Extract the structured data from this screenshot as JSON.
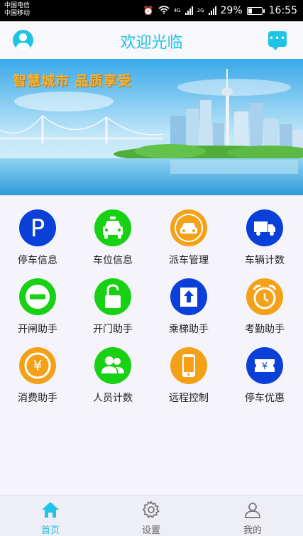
{
  "status_bar": {
    "carrier_1": "中国电信",
    "carrier_2": "中国移动",
    "network_1": "4G",
    "network_2": "2G",
    "battery": "29%",
    "battery_level": 0.29,
    "time": "16:55"
  },
  "header": {
    "title": "欢迎光临",
    "left_icon": "user-avatar-icon",
    "right_icon": "message-bubble-icon"
  },
  "banner": {
    "caption": "智慧城市  品质享受"
  },
  "grid": [
    {
      "label": "停车信息",
      "icon": "parking-icon",
      "color": "#0a3fd8"
    },
    {
      "label": "车位信息",
      "icon": "taxi-icon",
      "color": "#17d112"
    },
    {
      "label": "派车管理",
      "icon": "car-dispatch-icon",
      "color": "#f5a117"
    },
    {
      "label": "车辆计数",
      "icon": "truck-icon",
      "color": "#0a3fd8"
    },
    {
      "label": "开闸助手",
      "icon": "no-entry-icon",
      "color": "#17d112"
    },
    {
      "label": "开门助手",
      "icon": "padlock-icon",
      "color": "#17d112"
    },
    {
      "label": "乘梯助手",
      "icon": "elevator-up-icon",
      "color": "#0a3fd8"
    },
    {
      "label": "考勤助手",
      "icon": "alarm-clock-icon",
      "color": "#f5a117"
    },
    {
      "label": "消费助手",
      "icon": "yuan-coin-icon",
      "color": "#f5a117"
    },
    {
      "label": "人员计数",
      "icon": "people-icon",
      "color": "#17d112"
    },
    {
      "label": "远程控制",
      "icon": "smartphone-icon",
      "color": "#f5a117"
    },
    {
      "label": "停车优惠",
      "icon": "coupon-icon",
      "color": "#0a3fd8"
    }
  ],
  "bottom_nav": [
    {
      "label": "首页",
      "icon": "home-icon",
      "active": true
    },
    {
      "label": "设置",
      "icon": "settings-gear-icon",
      "active": false
    },
    {
      "label": "我的",
      "icon": "user-profile-icon",
      "active": false
    }
  ],
  "colors": {
    "accent": "#1ec3e6",
    "blue": "#0a3fd8",
    "green": "#17d112",
    "orange": "#f5a117"
  }
}
